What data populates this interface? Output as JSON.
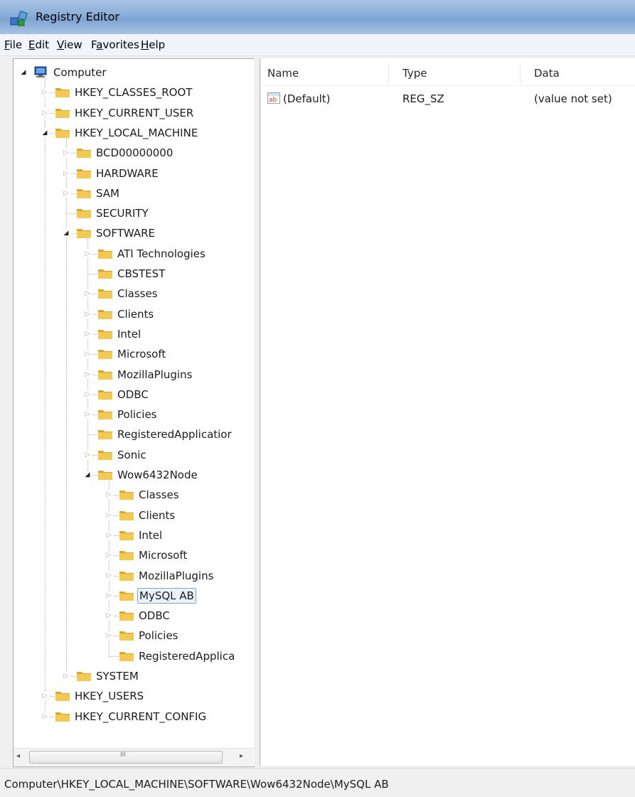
{
  "window": {
    "title": "Registry Editor"
  },
  "menu": [
    {
      "key": "F",
      "rest": "ile"
    },
    {
      "key": "E",
      "rest": "dit"
    },
    {
      "key": "V",
      "rest": "iew"
    },
    {
      "pre": "F",
      "key": "a",
      "rest": "vorites"
    },
    {
      "key": "H",
      "rest": "elp"
    }
  ],
  "tree": {
    "nodes": [
      {
        "label": "Computer",
        "depth": 0,
        "expander": "open",
        "icon": "computer-icon"
      },
      {
        "label": "HKEY_CLASSES_ROOT",
        "depth": 1,
        "expander": "closed"
      },
      {
        "label": "HKEY_CURRENT_USER",
        "depth": 1,
        "expander": "closed"
      },
      {
        "label": "HKEY_LOCAL_MACHINE",
        "depth": 1,
        "expander": "open"
      },
      {
        "label": "BCD00000000",
        "depth": 2,
        "expander": "closed"
      },
      {
        "label": "HARDWARE",
        "depth": 2,
        "expander": "closed"
      },
      {
        "label": "SAM",
        "depth": 2,
        "expander": "closed"
      },
      {
        "label": "SECURITY",
        "depth": 2,
        "expander": "none"
      },
      {
        "label": "SOFTWARE",
        "depth": 2,
        "expander": "open"
      },
      {
        "label": "ATI Technologies",
        "depth": 3,
        "expander": "closed"
      },
      {
        "label": "CBSTEST",
        "depth": 3,
        "expander": "none"
      },
      {
        "label": "Classes",
        "depth": 3,
        "expander": "closed"
      },
      {
        "label": "Clients",
        "depth": 3,
        "expander": "closed"
      },
      {
        "label": "Intel",
        "depth": 3,
        "expander": "closed"
      },
      {
        "label": "Microsoft",
        "depth": 3,
        "expander": "closed"
      },
      {
        "label": "MozillaPlugins",
        "depth": 3,
        "expander": "closed"
      },
      {
        "label": "ODBC",
        "depth": 3,
        "expander": "closed"
      },
      {
        "label": "Policies",
        "depth": 3,
        "expander": "closed"
      },
      {
        "label": "RegisteredApplicatior",
        "depth": 3,
        "expander": "none"
      },
      {
        "label": "Sonic",
        "depth": 3,
        "expander": "closed"
      },
      {
        "label": "Wow6432Node",
        "depth": 3,
        "expander": "open"
      },
      {
        "label": "Classes",
        "depth": 4,
        "expander": "closed"
      },
      {
        "label": "Clients",
        "depth": 4,
        "expander": "closed"
      },
      {
        "label": "Intel",
        "depth": 4,
        "expander": "closed"
      },
      {
        "label": "Microsoft",
        "depth": 4,
        "expander": "closed"
      },
      {
        "label": "MozillaPlugins",
        "depth": 4,
        "expander": "closed"
      },
      {
        "label": "MySQL AB",
        "depth": 4,
        "expander": "closed",
        "selected": true
      },
      {
        "label": "ODBC",
        "depth": 4,
        "expander": "closed"
      },
      {
        "label": "Policies",
        "depth": 4,
        "expander": "closed"
      },
      {
        "label": "RegisteredApplica",
        "depth": 4,
        "expander": "none"
      },
      {
        "label": "SYSTEM",
        "depth": 2,
        "expander": "closed"
      },
      {
        "label": "HKEY_USERS",
        "depth": 1,
        "expander": "closed"
      },
      {
        "label": "HKEY_CURRENT_CONFIG",
        "depth": 1,
        "expander": "closed"
      }
    ]
  },
  "scrollbar": {
    "left_arrow": "◂",
    "right_arrow": "▸",
    "grip": "III"
  },
  "list": {
    "headers": {
      "name": "Name",
      "type": "Type",
      "data": "Data"
    },
    "rows": [
      {
        "name": "(Default)",
        "type": "REG_SZ",
        "data": "(value not set)",
        "icon": "ab-string-icon"
      }
    ]
  },
  "status": {
    "path": "Computer\\HKEY_LOCAL_MACHINE\\SOFTWARE\\Wow6432Node\\MySQL AB"
  },
  "colors": {
    "folder": "#f2c857",
    "folder_dark": "#d9a52b",
    "selection": "#eaf2fc",
    "selection_border": "#7da2ce",
    "title_bar": "#8aaed9"
  }
}
